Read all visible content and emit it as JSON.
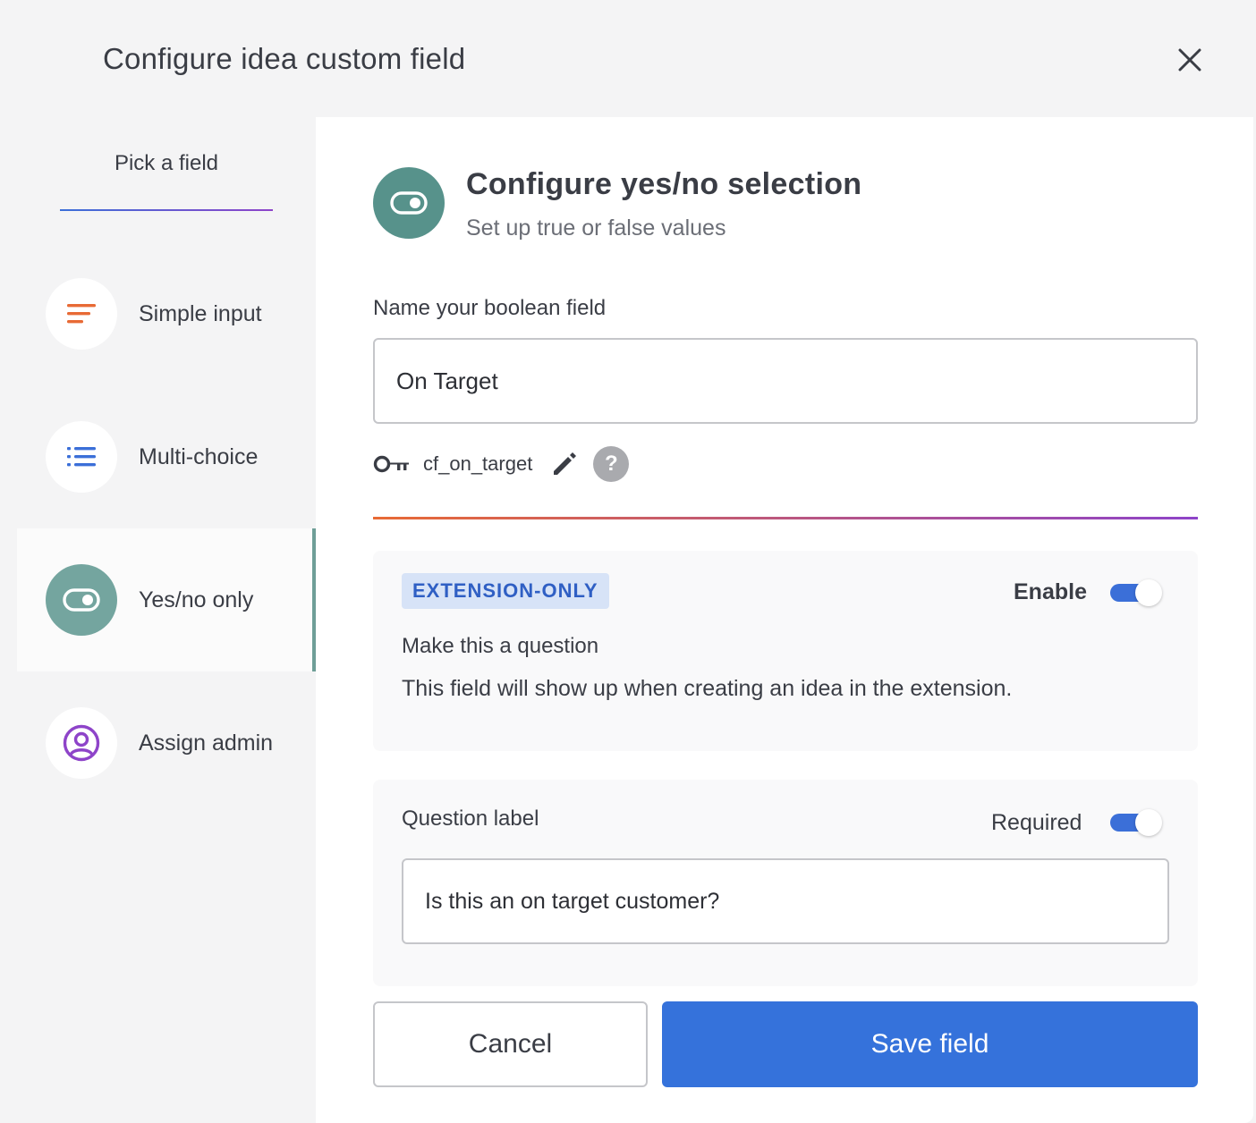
{
  "header": {
    "title": "Configure idea custom field",
    "close_icon": "close-icon"
  },
  "sidebar": {
    "title": "Pick a field",
    "items": [
      {
        "label": "Simple input",
        "icon": "text-lines-icon",
        "icon_color": "#e86a35"
      },
      {
        "label": "Multi-choice",
        "icon": "list-icon",
        "icon_color": "#3b6fd8"
      },
      {
        "label": "Yes/no only",
        "icon": "toggle-icon",
        "icon_color": "#ffffff",
        "active": true
      },
      {
        "label": "Assign admin",
        "icon": "user-circle-icon",
        "icon_color": "#8e44c9"
      }
    ]
  },
  "main": {
    "title": "Configure yes/no selection",
    "subtitle": "Set up true or false values",
    "name_label": "Name your boolean field",
    "name_value": "On Target",
    "key": "cf_on_target",
    "help": "?",
    "extension": {
      "badge": "EXTENSION-ONLY",
      "enable_label": "Enable",
      "enabled": true,
      "question_title": "Make this a question",
      "question_desc": "This field will show up when creating an idea in the extension."
    },
    "question": {
      "label": "Question label",
      "required_label": "Required",
      "required": true,
      "value": "Is this an on target customer?"
    },
    "buttons": {
      "cancel": "Cancel",
      "save": "Save field"
    }
  },
  "colors": {
    "accent_blue": "#3572db",
    "teal": "#57928b",
    "orange": "#e86a35",
    "purple": "#8e44c9"
  }
}
